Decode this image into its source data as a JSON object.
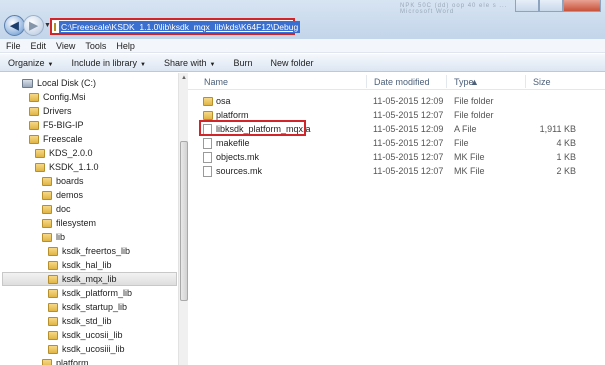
{
  "window": {
    "title_text": "NPK 50C (dd) oop 40 ele s ... Microsoft Word"
  },
  "address_bar": {
    "path": "C:\\Freescale\\KSDK_1.1.0\\lib\\ksdk_mqx_lib\\kds\\K64F12\\Debug"
  },
  "menu": [
    "File",
    "Edit",
    "View",
    "Tools",
    "Help"
  ],
  "command_bar": [
    {
      "label": "Organize",
      "dropdown": true
    },
    {
      "label": "Include in library",
      "dropdown": true
    },
    {
      "label": "Share with",
      "dropdown": true
    },
    {
      "label": "Burn",
      "dropdown": false
    },
    {
      "label": "New folder",
      "dropdown": false
    }
  ],
  "tree": [
    {
      "label": "Local Disk (C:)",
      "icon": "drive-icon",
      "selected": false
    },
    {
      "label": "Config.Msi",
      "icon": "folder-icon",
      "selected": false
    },
    {
      "label": "Drivers",
      "icon": "folder-icon",
      "selected": false
    },
    {
      "label": "F5-BIG-IP",
      "icon": "folder-icon",
      "selected": false
    },
    {
      "label": "Freescale",
      "icon": "folder-icon",
      "selected": false
    },
    {
      "label": "KDS_2.0.0",
      "icon": "folder-icon",
      "selected": false
    },
    {
      "label": "KSDK_1.1.0",
      "icon": "folder-icon",
      "selected": false
    },
    {
      "label": "boards",
      "icon": "folder-icon",
      "selected": false
    },
    {
      "label": "demos",
      "icon": "folder-icon",
      "selected": false
    },
    {
      "label": "doc",
      "icon": "folder-icon",
      "selected": false
    },
    {
      "label": "filesystem",
      "icon": "folder-icon",
      "selected": false
    },
    {
      "label": "lib",
      "icon": "folder-icon",
      "selected": false
    },
    {
      "label": "ksdk_freertos_lib",
      "icon": "folder-icon",
      "selected": false
    },
    {
      "label": "ksdk_hal_lib",
      "icon": "folder-icon",
      "selected": false
    },
    {
      "label": "ksdk_mqx_lib",
      "icon": "folder-icon",
      "selected": true
    },
    {
      "label": "ksdk_platform_lib",
      "icon": "folder-icon",
      "selected": false
    },
    {
      "label": "ksdk_startup_lib",
      "icon": "folder-icon",
      "selected": false
    },
    {
      "label": "ksdk_std_lib",
      "icon": "folder-icon",
      "selected": false
    },
    {
      "label": "ksdk_ucosii_lib",
      "icon": "folder-icon",
      "selected": false
    },
    {
      "label": "ksdk_ucosiii_lib",
      "icon": "folder-icon",
      "selected": false
    },
    {
      "label": "platform",
      "icon": "folder-icon",
      "selected": false
    }
  ],
  "columns": {
    "name": "Name",
    "date": "Date modified",
    "type": "Type",
    "size": "Size"
  },
  "files": [
    {
      "name": "osa",
      "date": "11-05-2015 12:09",
      "type": "File folder",
      "size": "",
      "icon": "folder-icon"
    },
    {
      "name": "platform",
      "date": "11-05-2015 12:07",
      "type": "File folder",
      "size": "",
      "icon": "folder-icon"
    },
    {
      "name": "libksdk_platform_mqx.a",
      "date": "11-05-2015 12:09",
      "type": "A File",
      "size": "1,911 KB",
      "icon": "file-icon"
    },
    {
      "name": "makefile",
      "date": "11-05-2015 12:07",
      "type": "File",
      "size": "4 KB",
      "icon": "file-icon"
    },
    {
      "name": "objects.mk",
      "date": "11-05-2015 12:07",
      "type": "MK File",
      "size": "1 KB",
      "icon": "file-icon"
    },
    {
      "name": "sources.mk",
      "date": "11-05-2015 12:07",
      "type": "MK File",
      "size": "2 KB",
      "icon": "file-icon"
    }
  ],
  "colors": {
    "highlight_border": "#d0262a",
    "address_selection": "#3a6fd0"
  }
}
